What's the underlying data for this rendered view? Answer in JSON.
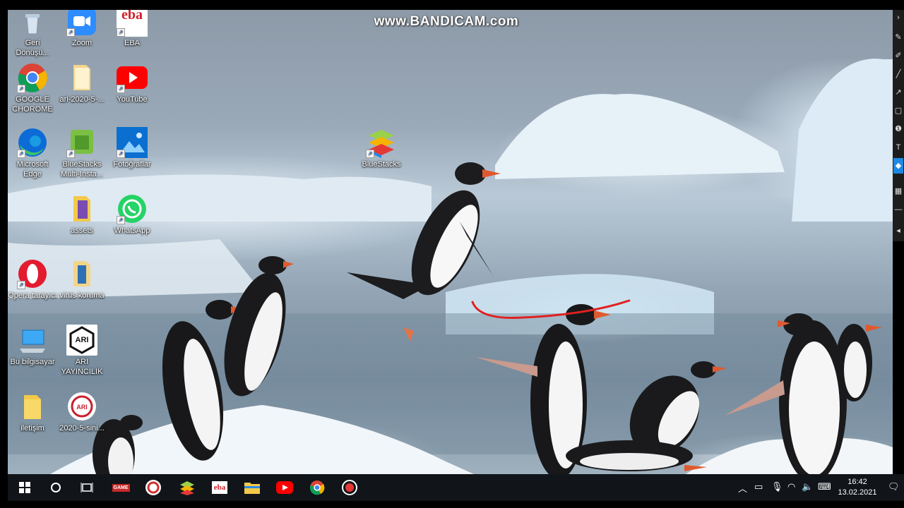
{
  "watermark": "www.BANDICAM.com",
  "desktop_icons": [
    {
      "label": "Geri Dönüşü...",
      "icon": "recycle-bin-icon"
    },
    {
      "label": "Zoom",
      "icon": "zoom-icon"
    },
    {
      "label": "EBA",
      "icon": "eba-icon",
      "icon_text": "eba"
    },
    {
      "label": "GOOGLE CHOROME",
      "icon": "chrome-icon"
    },
    {
      "label": "ari-2020-5-...",
      "icon": "folder-icon"
    },
    {
      "label": "YouTube",
      "icon": "youtube-icon"
    },
    {
      "label": "Microsoft Edge",
      "icon": "edge-icon"
    },
    {
      "label": "BlueStacks Multi-Insta...",
      "icon": "bluestacks-multi-icon"
    },
    {
      "label": "Fotoğraflar",
      "icon": "photos-icon"
    },
    {
      "label": "assets",
      "icon": "folder-icon"
    },
    {
      "label": "WhatsApp",
      "icon": "whatsapp-icon"
    },
    {
      "label": "Opera tarayıcı",
      "icon": "opera-icon"
    },
    {
      "label": "virüs koruma",
      "icon": "folder-icon"
    },
    {
      "label": "Bu bilgisayar",
      "icon": "computer-icon"
    },
    {
      "label": "ARI YAYINCILIK",
      "icon": "ari-icon",
      "icon_text": "ARI"
    },
    {
      "label": "iletişim",
      "icon": "folder-icon"
    },
    {
      "label": "2020-5-sini...",
      "icon": "ari-red-icon",
      "icon_text": "ARI"
    },
    {
      "label": "BlueStacks",
      "icon": "bluestacks-icon"
    }
  ],
  "taskbar": {
    "apps": [
      "start-icon",
      "search-icon",
      "task-view-icon",
      "game-icon",
      "red-app-icon",
      "bluestacks-icon",
      "eba-icon",
      "file-explorer-icon",
      "youtube-icon",
      "chrome-icon",
      "record-icon"
    ],
    "game_text": "GAME",
    "eba_text": "eba",
    "tray_icons": [
      "chevron-up-icon",
      "battery-icon",
      "microphone-icon",
      "wifi-icon",
      "volume-icon",
      "keyboard-icon"
    ],
    "time": "16:42",
    "date": "13.02.2021",
    "notification_icon": "notification-icon"
  },
  "colors": {
    "taskbar_bg": "#111419",
    "annotation_stroke": "#e02020"
  }
}
